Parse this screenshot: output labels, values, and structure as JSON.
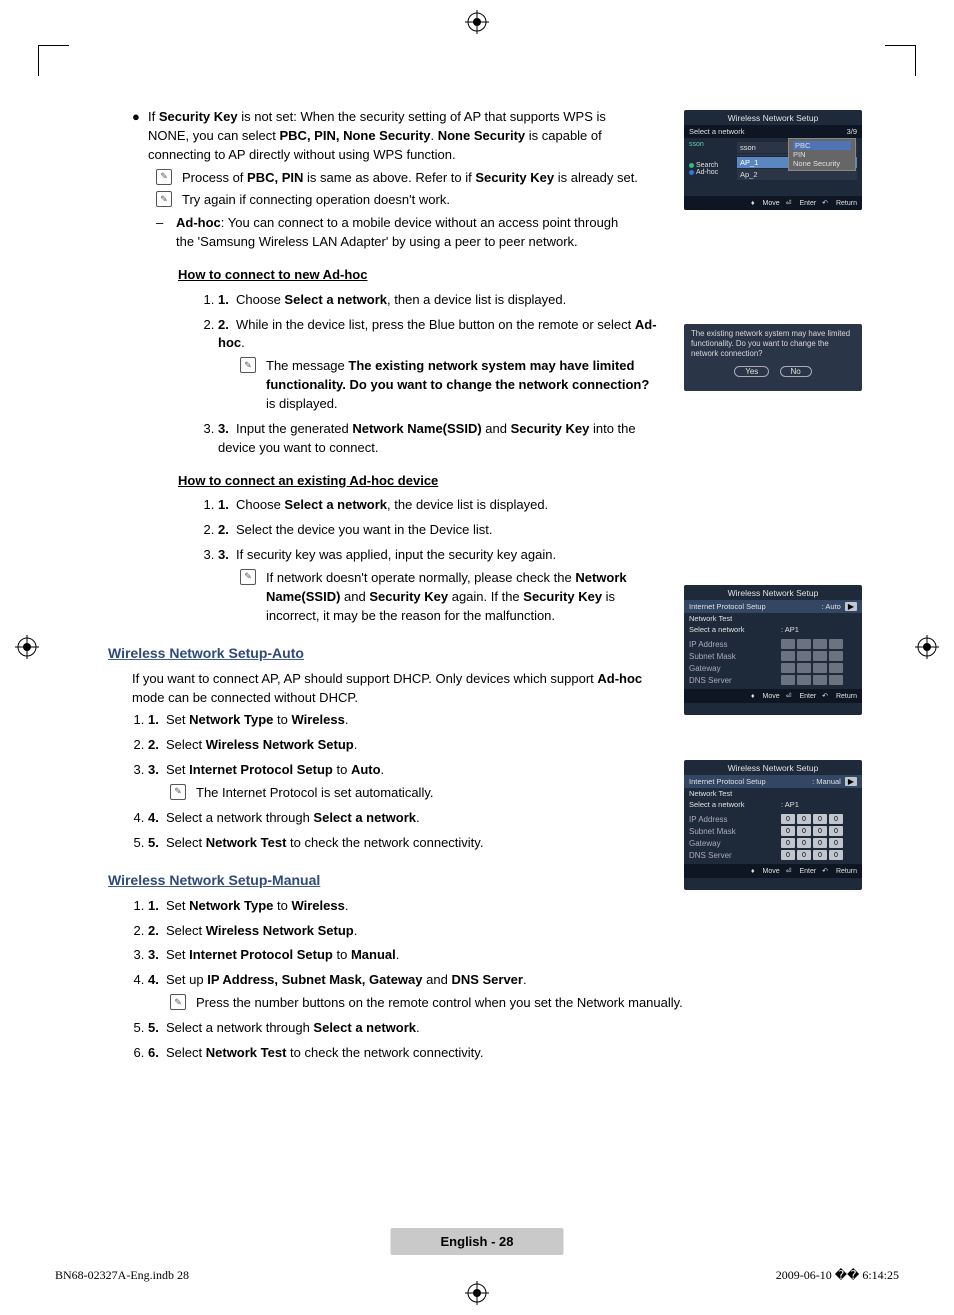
{
  "para1_pre": "If ",
  "para1_b1": "Security Key",
  "para1_mid1": " is not set: When the security setting of AP that supports WPS is NONE, you can select ",
  "para1_b2": "PBC, PIN, None Security",
  "para1_mid2": ". ",
  "para1_b3": "None Security",
  "para1_mid3": " is capable of connecting to AP directly without using WPS function.",
  "note1_pre": "Process of ",
  "note1_b": "PBC, PIN",
  "note1_mid": " is same as above. Refer to if ",
  "note1_b2": "Security Key",
  "note1_end": " is already set.",
  "note2": "Try again if connecting operation doesn't work.",
  "adhoc_b": "Ad-hoc",
  "adhoc_text": ": You can connect to a mobile device without an access point through the 'Samsung Wireless LAN Adapter' by using a peer to peer network.",
  "h_newadhoc": "How to connect to new Ad-hoc",
  "s1a_pre": "Choose ",
  "s1a_b": "Select a network",
  "s1a_end": ", then a device list is displayed.",
  "s1b_pre": "While in the device list, press the Blue button on the remote or select ",
  "s1b_b": "Ad-hoc",
  "s1b_end": ".",
  "s1b_note_pre": "The message ",
  "s1b_note_b": "The existing network system may have limited functionality. Do you want to change the network connection?",
  "s1b_note_end": " is displayed.",
  "s1c_pre": "Input the generated ",
  "s1c_b1": "Network Name(SSID)",
  "s1c_mid": " and ",
  "s1c_b2": "Security Key",
  "s1c_end": " into the device you want to connect.",
  "h_existadhoc": "How to connect an existing Ad-hoc device",
  "s2a_pre": "Choose ",
  "s2a_b": "Select a network",
  "s2a_end": ", the device list is displayed.",
  "s2b": "Select the device you want in the Device list.",
  "s2c": "If security key was applied, input the security key again.",
  "s2c_note_pre": "If network doesn't operate normally, please check the ",
  "s2c_note_b1": "Network Name(SSID)",
  "s2c_note_mid": " and ",
  "s2c_note_b2": "Security Key",
  "s2c_note_mid2": " again. If the ",
  "s2c_note_b3": "Security Key",
  "s2c_note_end": " is incorrect, it may be the reason for the malfunction.",
  "sec_auto": "Wireless Network Setup-Auto",
  "auto_intro_pre": "If you want to connect AP, AP should support DHCP. Only devices which support ",
  "auto_intro_b": "Ad-hoc",
  "auto_intro_end": " mode can be connected without DHCP.",
  "a1_pre": "Set ",
  "a1_b1": "Network Type",
  "a1_mid": " to ",
  "a1_b2": "Wireless",
  "a1_end": ".",
  "a2_pre": "Select ",
  "a2_b": "Wireless Network Setup",
  "a2_end": ".",
  "a3_pre": "Set ",
  "a3_b1": "Internet Protocol Setup",
  "a3_mid": " to ",
  "a3_b2": "Auto",
  "a3_end": ".",
  "a3_note": "The Internet Protocol is set automatically.",
  "a4_pre": "Select a network through ",
  "a4_b": "Select a network",
  "a4_end": ".",
  "a5_pre": "Select ",
  "a5_b": "Network Test",
  "a5_end": " to check the network connectivity.",
  "sec_manual": "Wireless Network Setup-Manual",
  "m1_pre": "Set ",
  "m1_b1": "Network Type",
  "m1_mid": " to ",
  "m1_b2": "Wireless",
  "m1_end": ".",
  "m2_pre": "Select ",
  "m2_b": "Wireless Network Setup",
  "m2_end": ".",
  "m3_pre": "Set ",
  "m3_b1": "Internet Protocol Setup",
  "m3_mid": " to ",
  "m3_b2": "Manual",
  "m3_end": ".",
  "m4_pre": "Set up ",
  "m4_b1": "IP Address, Subnet Mask, Gateway",
  "m4_mid": " and ",
  "m4_b2": "DNS Server",
  "m4_end": ".",
  "m4_note": "Press the number buttons on the remote control when you set the Network manually.",
  "m5_pre": "Select a network through ",
  "m5_b": "Select a network",
  "m5_end": ".",
  "m6_pre": "Select ",
  "m6_b": "Network Test",
  "m6_end": " to check the network connectivity.",
  "shot1": {
    "title": "Wireless Network Setup",
    "select": "Select a network",
    "counter": "3/9",
    "items": [
      "sson",
      "",
      "AP_1",
      "Ap_2"
    ],
    "btn_search": "Search",
    "btn_adhoc": "Ad-hoc",
    "popup": [
      "PBC",
      "PIN",
      "None Security"
    ],
    "foot_move": "Move",
    "foot_enter": "Enter",
    "foot_return": "Return"
  },
  "shot2": {
    "msg": "The existing network system may have limited functionality. Do you want to change the network connection?",
    "yes": "Yes",
    "no": "No"
  },
  "shot3": {
    "title": "Wireless Network Setup",
    "ips": "Internet Protocol Setup",
    "mode": "Auto",
    "nt": "Network Test",
    "san": "Select a network",
    "ap": "AP1",
    "ip": "IP Address",
    "sm": "Subnet Mask",
    "gw": "Gateway",
    "dns": "DNS Server",
    "foot_move": "Move",
    "foot_enter": "Enter",
    "foot_return": "Return"
  },
  "shot4": {
    "title": "Wireless Network Setup",
    "ips": "Internet Protocol Setup",
    "mode": "Manual",
    "nt": "Network Test",
    "san": "Select a network",
    "ap": "AP1",
    "ip": "IP Address",
    "sm": "Subnet Mask",
    "gw": "Gateway",
    "dns": "DNS Server",
    "cells": [
      [
        "0",
        ".",
        "0",
        ".",
        "0",
        ".",
        "0"
      ],
      [
        "0",
        ".",
        "0",
        ".",
        "0",
        ".",
        "0"
      ],
      [
        "0",
        ".",
        "0",
        ".",
        "0",
        ".",
        "0"
      ],
      [
        "0",
        ".",
        "0",
        ".",
        "0",
        ".",
        "0"
      ]
    ],
    "foot_move": "Move",
    "foot_enter": "Enter",
    "foot_return": "Return"
  },
  "pgnum": "English - 28",
  "footer_left": "BN68-02327A-Eng.indb   28",
  "footer_right": "2009-06-10   �� 6:14:25"
}
